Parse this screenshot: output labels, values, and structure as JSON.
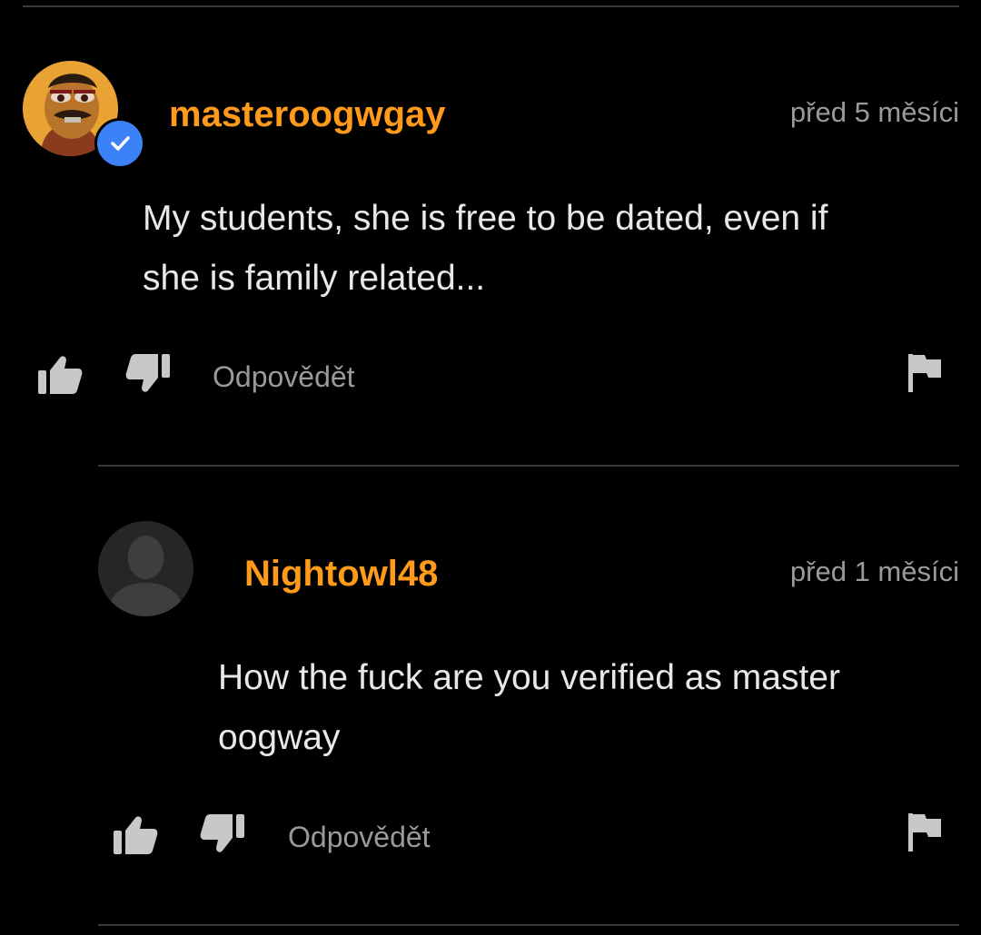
{
  "comments": [
    {
      "username": "masteroogwgay",
      "verified": true,
      "timestamp": "před 5 měsíci",
      "text_line1": "My students, she is free to be dated, even if",
      "text_line2": "she is family related...",
      "reply_label": "Odpovědět"
    },
    {
      "username": "Nightowl48",
      "verified": false,
      "timestamp": "před 1 měsíci",
      "text_line1": "How the fuck are you verified as master",
      "text_line2": "oogway",
      "reply_label": "Odpovědět"
    }
  ],
  "colors": {
    "background": "#000000",
    "username": "#ff9a1a",
    "muted_text": "#9a9a9a",
    "body_text": "#e8e8e8",
    "verified_badge": "#3b82f6",
    "divider": "#3a3a3a"
  },
  "icons": [
    "thumbs-up-icon",
    "thumbs-down-icon",
    "flag-icon",
    "checkmark-icon",
    "default-user-icon"
  ]
}
